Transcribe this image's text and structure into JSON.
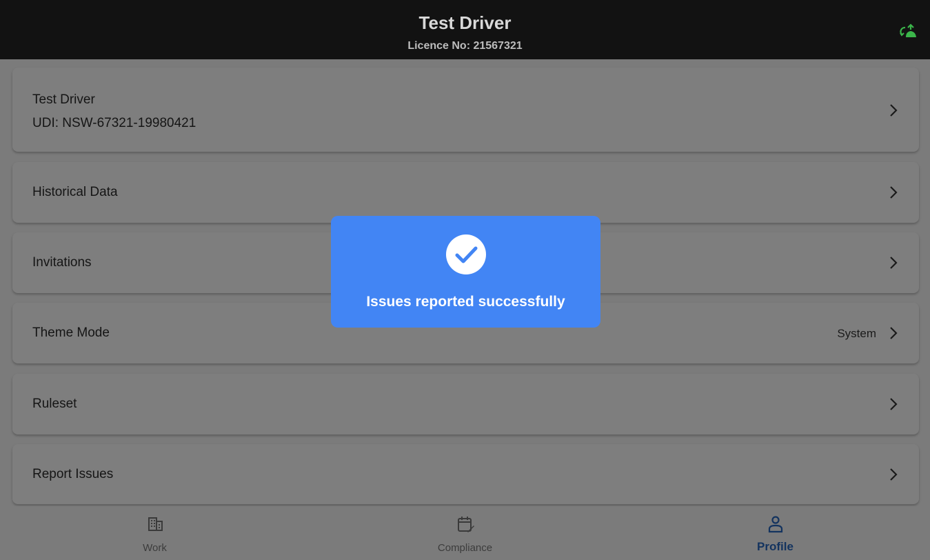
{
  "header": {
    "title": "Test Driver",
    "subtitle": "Licence No: 21567321",
    "sync_icon": "cloud-sync-icon",
    "sync_color": "#3bb54a"
  },
  "list": {
    "profile": {
      "name": "Test Driver",
      "udi": "UDI: NSW-67321-19980421"
    },
    "historical_data": "Historical Data",
    "invitations": "Invitations",
    "theme_mode": {
      "label": "Theme Mode",
      "value": "System"
    },
    "ruleset": "Ruleset",
    "report_issues": "Report Issues"
  },
  "toast": {
    "icon": "check-circle-icon",
    "message": "Issues reported successfully",
    "color": "#4285f4"
  },
  "bottom_nav": {
    "items": [
      {
        "label": "Work",
        "icon": "building-icon"
      },
      {
        "label": "Compliance",
        "icon": "calendar-edit-icon"
      },
      {
        "label": "Profile",
        "icon": "person-icon"
      }
    ],
    "active": "Profile",
    "active_color": "#13335f"
  }
}
